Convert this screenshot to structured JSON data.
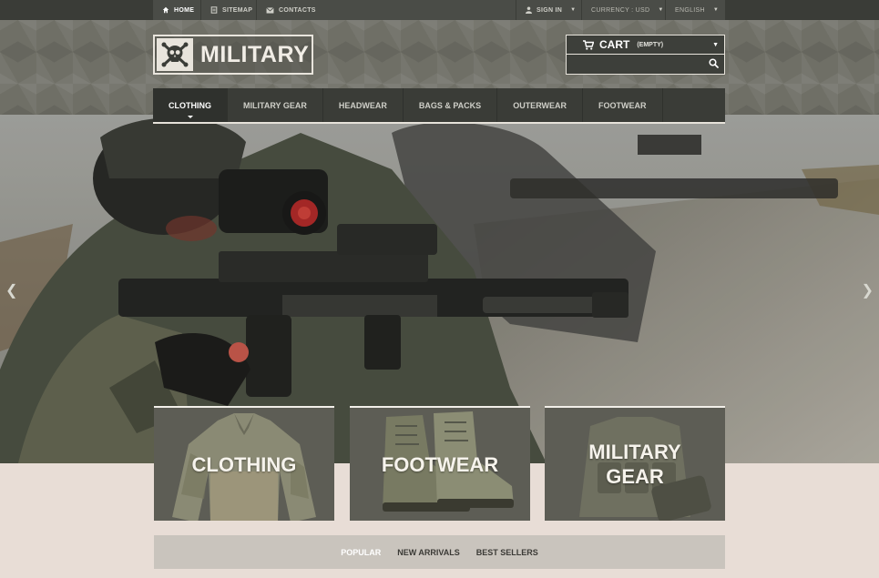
{
  "topbar": {
    "home": "HOME",
    "sitemap": "SITEMAP",
    "contacts": "CONTACTS",
    "signin": "SIGN IN",
    "currency": "CURRENCY : USD",
    "language": "ENGLISH"
  },
  "header": {
    "logo_text": "MILITARY",
    "cart_label": "CART",
    "cart_status": "(EMPTY)",
    "search_value": "",
    "search_placeholder": ""
  },
  "nav": {
    "items": [
      "CLOTHING",
      "MILITARY GEAR",
      "HEADWEAR",
      "BAGS & PACKS",
      "OUTERWEAR",
      "FOOTWEAR"
    ],
    "active": "CLOTHING"
  },
  "hero": {
    "prev_icon": "chevron-left-icon",
    "next_icon": "chevron-right-icon"
  },
  "tiles": [
    {
      "title": "CLOTHING"
    },
    {
      "title": "FOOTWEAR"
    },
    {
      "title_line1": "MILITARY",
      "title_line2": "GEAR"
    }
  ],
  "product_tabs": {
    "items": [
      "POPULAR",
      "NEW ARRIVALS",
      "BEST SELLERS"
    ],
    "active": "POPULAR"
  },
  "colors": {
    "bar": "#3a3c37",
    "header": "#6f6f66",
    "page_bg": "#e8ddd6",
    "tab_strip": "#c9c4bd"
  }
}
